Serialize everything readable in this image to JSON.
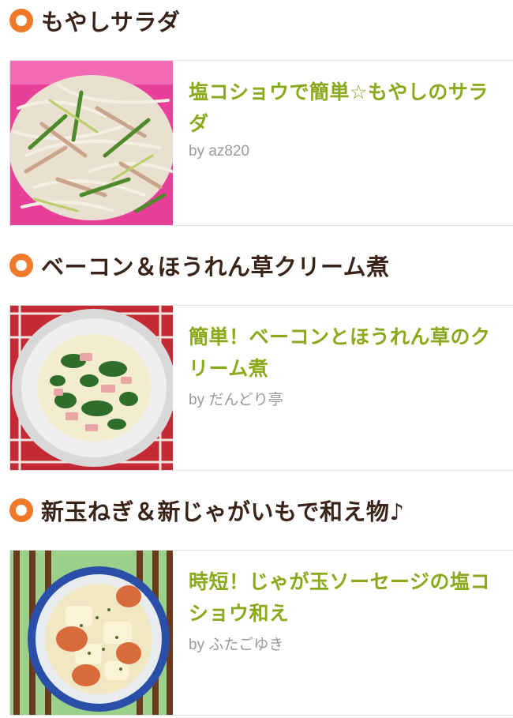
{
  "sections": [
    {
      "heading": "もやしサラダ",
      "recipe": {
        "title": "塩コショウで簡単☆もやしのサラダ",
        "author": "by az820",
        "image": "bean-sprout-salad-photo"
      }
    },
    {
      "heading": "ベーコン＆ほうれん草クリーム煮",
      "recipe": {
        "title": "簡単！ベーコンとほうれん草のクリーム煮",
        "author": "by だんどり亭",
        "image": "bacon-spinach-cream-stew-photo"
      }
    },
    {
      "heading": "新玉ねぎ＆新じゃがいもで和え物♪",
      "recipe": {
        "title": "時短！じゃが玉ソーセージの塩コショウ和え",
        "author": "by ふたごゆき",
        "image": "potato-onion-sausage-photo"
      }
    }
  ],
  "colors": {
    "bullet": "#f07a2a",
    "heading": "#3a2418",
    "recipe_title": "#8aaa1b",
    "author": "#9a9a9a"
  }
}
